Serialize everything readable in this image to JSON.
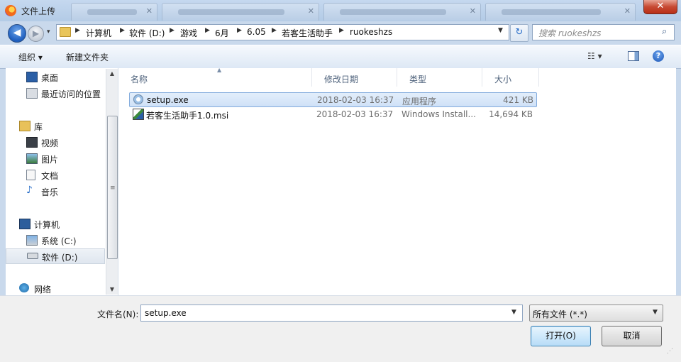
{
  "window": {
    "title": "文件上传",
    "close_label": "✕"
  },
  "background_tabs": [
    {
      "close": "✕"
    },
    {
      "close": "✕"
    },
    {
      "close": "✕"
    },
    {
      "close": "✕"
    }
  ],
  "nav": {
    "back": "◀",
    "forward": "▶",
    "history_dropdown": "▾",
    "breadcrumb": [
      "计算机",
      "软件 (D:)",
      "游戏",
      "6月",
      "6.05",
      "若客生活助手",
      "ruokeshzs"
    ],
    "refresh": "↻",
    "search_placeholder": "搜索 ruokeshzs"
  },
  "toolbar": {
    "organize": "组织 ▾",
    "new_folder": "新建文件夹",
    "view": "☷ ▾",
    "help": "?"
  },
  "sidebar": {
    "items": [
      {
        "label": "桌面",
        "icon": "desktop-icon",
        "group": false
      },
      {
        "label": "最近访问的位置",
        "icon": "recent-places-icon",
        "group": false
      },
      {
        "label": "库",
        "icon": "library-icon",
        "group": true
      },
      {
        "label": "视频",
        "icon": "video-icon",
        "group": false
      },
      {
        "label": "图片",
        "icon": "pictures-icon",
        "group": false
      },
      {
        "label": "文档",
        "icon": "documents-icon",
        "group": false
      },
      {
        "label": "音乐",
        "icon": "music-icon",
        "group": false
      },
      {
        "label": "计算机",
        "icon": "computer-icon",
        "group": true
      },
      {
        "label": "系统 (C:)",
        "icon": "system-drive-icon",
        "group": false
      },
      {
        "label": "软件 (D:)",
        "icon": "drive-icon",
        "group": false,
        "selected": true
      },
      {
        "label": "网络",
        "icon": "network-icon",
        "group": true
      }
    ],
    "scroll_grip": "≡"
  },
  "columns": {
    "name": "名称",
    "modified": "修改日期",
    "type": "类型",
    "size": "大小"
  },
  "files": [
    {
      "name": "setup.exe",
      "modified": "2018-02-03 16:37",
      "type": "应用程序",
      "size": "421 KB",
      "selected": true
    },
    {
      "name": "若客生活助手1.0.msi",
      "modified": "2018-02-03 16:37",
      "type": "Windows Install...",
      "size": "14,694 KB",
      "selected": false
    }
  ],
  "footer": {
    "filename_label": "文件名(N):",
    "filename_value": "setup.exe",
    "filter_value": "所有文件 (*.*)",
    "open_label": "打开(O)",
    "cancel_label": "取消"
  },
  "colors": {
    "accent": "#1f5fbf",
    "selection": "#cfe1f7",
    "chrome": "#c9d9ec"
  }
}
